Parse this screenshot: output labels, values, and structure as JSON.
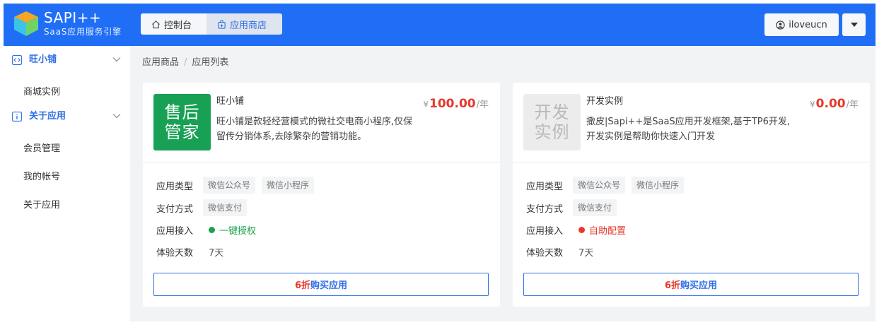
{
  "header": {
    "brand_title": "SAPI++",
    "brand_subtitle": "SaaS应用服务引擎",
    "tabs": [
      {
        "label": "控制台",
        "icon": "home-icon"
      },
      {
        "label": "应用商店",
        "icon": "store-icon",
        "active": true
      }
    ],
    "user_name": "iloveucn"
  },
  "sidebar": {
    "groups": [
      {
        "label": "旺小铺",
        "icon": "code-icon",
        "items": [
          "商城实例"
        ]
      },
      {
        "label": "关于应用",
        "icon": "info-icon",
        "items": [
          "会员管理",
          "我的帐号",
          "关于应用"
        ]
      }
    ]
  },
  "breadcrumb": [
    "应用商品",
    "应用列表"
  ],
  "labels": {
    "app_type": "应用类型",
    "payment": "支付方式",
    "access": "应用接入",
    "trial_days": "体验天数",
    "currency": "¥",
    "per_year": "/年"
  },
  "cards": [
    {
      "thumb_lines": [
        "售后",
        "管家"
      ],
      "name": "旺小铺",
      "description": "旺小铺是款轻经营模式的微社交电商小程序,仅保留传分销体系,去除繁杂的营销功能。",
      "price": "100.00",
      "app_types": [
        "微信公众号",
        "微信小程序"
      ],
      "payment": [
        "微信支付"
      ],
      "access": "一键授权",
      "access_color": "#1aa34a",
      "trial": "7天",
      "buy_discount": "6折",
      "buy_label": "购买应用"
    },
    {
      "thumb_lines": [
        "开发",
        "实例"
      ],
      "name": "开发实例",
      "description": "撒皮|Sapi++是SaaS应用开发框架,基于TP6开发,开发实例是帮助你快速入门开发",
      "price": "0.00",
      "app_types": [
        "微信公众号",
        "微信小程序"
      ],
      "payment": [
        "微信支付"
      ],
      "access": "自助配置",
      "access_color": "#e8372c",
      "trial": "7天",
      "buy_discount": "6折",
      "buy_label": "购买应用"
    }
  ],
  "colors": {
    "header_bg": "#1f6ef5",
    "accent": "#2f6fe6",
    "price_red": "#e8372c"
  }
}
